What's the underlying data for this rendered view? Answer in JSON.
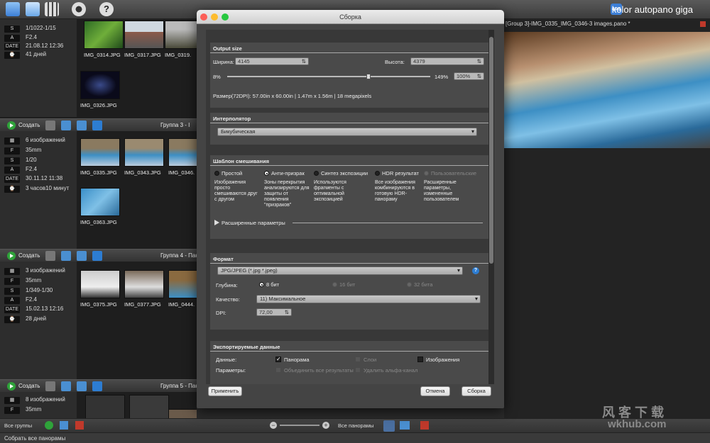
{
  "app": {
    "brand": "kolor autopano giga",
    "brand_logo": "apg"
  },
  "toolbar": {
    "icons": [
      "panorama-view-icon",
      "image-view-icon",
      "grid-icon",
      "settings-icon",
      "help-icon"
    ]
  },
  "group2": {
    "rows": [
      {
        "k": "S",
        "v": "1/1022-1/15"
      },
      {
        "k": "A",
        "v": "F2.4"
      },
      {
        "k": "DATE",
        "v": "21.08.12 12:36"
      },
      {
        "k": "⌚",
        "v": "41 дней"
      }
    ],
    "thumbs": [
      "IMG_0314.JPG",
      "IMG_0317.JPG",
      "IMG_0319.",
      "IMG_0326.JPG"
    ]
  },
  "group3": {
    "create": "Создать",
    "title": "Группа 3 - I",
    "rows": [
      {
        "k": "▦",
        "v": "6 изображений"
      },
      {
        "k": "F",
        "v": "35mm"
      },
      {
        "k": "S",
        "v": "1/20"
      },
      {
        "k": "A",
        "v": "F2.4"
      },
      {
        "k": "DATE",
        "v": "30.11.12 11:38"
      },
      {
        "k": "⌚",
        "v": "3 часов10 минут"
      }
    ],
    "thumbs": [
      "IMG_0335.JPG",
      "IMG_0343.JPG",
      "IMG_0346.",
      "IMG_0363.JPG"
    ]
  },
  "group4": {
    "create": "Создать",
    "title": "Группа 4 - Пан",
    "rows": [
      {
        "k": "▦",
        "v": "3 изображений"
      },
      {
        "k": "F",
        "v": "35mm"
      },
      {
        "k": "S",
        "v": "1/349-1/30"
      },
      {
        "k": "A",
        "v": "F2.4"
      },
      {
        "k": "DATE",
        "v": "15.02.13 12:16"
      },
      {
        "k": "⌚",
        "v": "28 дней"
      }
    ],
    "thumbs": [
      "IMG_0375.JPG",
      "IMG_0377.JPG",
      "IMG_0444."
    ]
  },
  "group5": {
    "create": "Создать",
    "title": "Группа 5 - Пан",
    "rows": [
      {
        "k": "▦",
        "v": "8 изображений"
      },
      {
        "k": "F",
        "v": "35mm"
      }
    ]
  },
  "bottom": {
    "all_groups": "Все группы",
    "all_panoramas": "Все панорамы"
  },
  "status": {
    "text": "Собрать все панорамы"
  },
  "right": {
    "title": "[Group 3]-IMG_0335_IMG_0346-3 images.pano *"
  },
  "dialog": {
    "title": "Сборка",
    "output": {
      "title": "Output size",
      "width_label": "Ширина:",
      "width": "4145",
      "height_label": "Высота:",
      "height": "4379",
      "min": "8%",
      "max": "149%",
      "pct": "100%",
      "size_info": "Размер(72DPI): 57.00in x 60.00in | 1.47m x 1.56m | 18 megapixels",
      "slider_value": 0.7
    },
    "interp": {
      "title": "Интерполятор",
      "value": "Бикубическая"
    },
    "blend": {
      "title": "Шаблон смешивания",
      "options": [
        {
          "label": "Простой",
          "desc": "Изображения просто смешиваются друг с другом",
          "selected": false,
          "disabled": false
        },
        {
          "label": "Анти-призрак",
          "desc": "Зоны перекрытия анализируются для защиты от появления \"призраков\"",
          "selected": true,
          "disabled": false
        },
        {
          "label": "Синтез экспозиции",
          "desc": "Используются фрагменты с оптимальной экспозицией",
          "selected": false,
          "disabled": false
        },
        {
          "label": "HDR результат",
          "desc": "Все изображения комбинируются в готовую HDR-панораму",
          "selected": false,
          "disabled": false
        },
        {
          "label": "Пользовательские",
          "desc": "Расширенные параметры, измененные пользователем",
          "selected": false,
          "disabled": true
        }
      ],
      "advanced": "Расширенные параметры"
    },
    "format": {
      "title": "Формат",
      "value": "JPG/JPEG (*.jpg *.jpeg)",
      "depth_label": "Глубина:",
      "depths": [
        "8 бит",
        "16 бит",
        "32 бита"
      ],
      "quality_label": "Качество:",
      "quality": "11) Максимальное",
      "dpi_label": "DPI:",
      "dpi": "72,00"
    },
    "export": {
      "title": "Экспортируемые данные",
      "data_label": "Данные:",
      "panorama": "Панорама",
      "layers": "Слои",
      "images": "Изображения",
      "params_label": "Параметры:",
      "merge": "Объединить все результаты",
      "remove_alpha": "Удалить альфа-канал"
    },
    "buttons": {
      "apply": "Применить",
      "cancel": "Отмена",
      "render": "Сборка"
    }
  },
  "watermark": {
    "line1": "风 客 下 载",
    "line2": "wkhub.com"
  }
}
